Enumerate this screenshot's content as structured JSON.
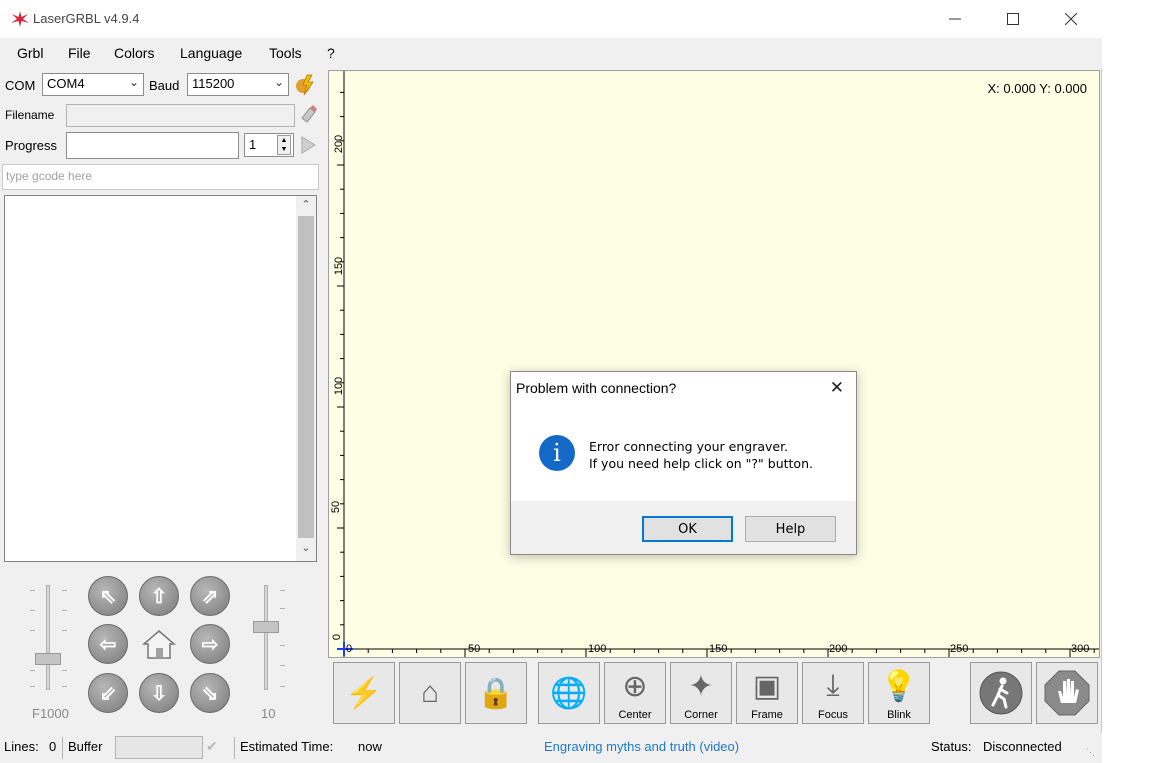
{
  "window": {
    "title": "LaserGRBL v4.9.4"
  },
  "menu": [
    "Grbl",
    "File",
    "Colors",
    "Language",
    "Tools",
    "?"
  ],
  "connection": {
    "com_label": "COM",
    "com_value": "COM4",
    "baud_label": "Baud",
    "baud_value": "115200"
  },
  "file": {
    "filename_label": "Filename",
    "progress_label": "Progress",
    "copies_value": "1"
  },
  "gcode": {
    "placeholder": "type gcode here"
  },
  "jog": {
    "speed_label": "F1000",
    "step_label": "10"
  },
  "canvas": {
    "coordinates": "X: 0.000 Y: 0.000",
    "y_ticks": [
      "200",
      "150",
      "100",
      "50",
      "0"
    ],
    "x_ticks": [
      "0",
      "50",
      "100",
      "150",
      "200",
      "250",
      "300"
    ]
  },
  "toolbar": {
    "center": "Center",
    "corner": "Corner",
    "frame": "Frame",
    "focus": "Focus",
    "blink": "Blink"
  },
  "status": {
    "lines_label": "Lines:",
    "lines_value": "0",
    "buffer_label": "Buffer",
    "estimated_label": "Estimated Time:",
    "estimated_value": "now",
    "link": "Engraving myths and truth (video)",
    "status_label": "Status:",
    "status_value": "Disconnected"
  },
  "dialog": {
    "title": "Problem with connection?",
    "line1": "Error connecting your engraver.",
    "line2": "If you need help click on \"?\" button.",
    "ok": "OK",
    "help": "Help"
  },
  "colors": {
    "canvas_bg": "#fefee5",
    "link": "#1e78c8",
    "info_icon": "#1469c7",
    "logo": "#d6283a"
  }
}
